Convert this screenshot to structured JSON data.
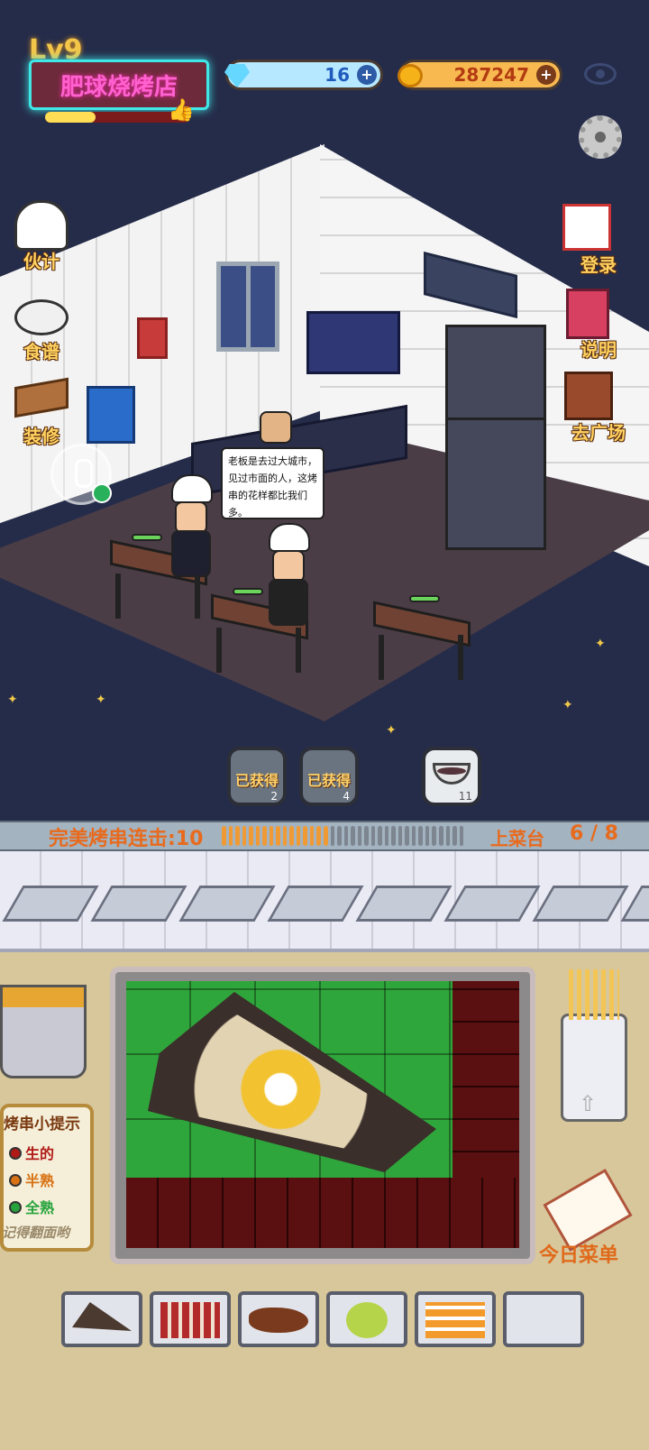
{
  "hud": {
    "level": "Lv9",
    "shop_name": "肥球烧烤店",
    "level_progress": 0.35,
    "gems": "16",
    "coins": "287247"
  },
  "left_menu": [
    {
      "label": "伙计",
      "icon": "chef-icon"
    },
    {
      "label": "食谱",
      "icon": "recipe-plate-icon"
    },
    {
      "label": "装修",
      "icon": "decorate-table-icon"
    }
  ],
  "right_menu": [
    {
      "label": "登录",
      "icon": "calendar-icon"
    },
    {
      "label": "说明",
      "icon": "book-icon"
    },
    {
      "label": "去广场",
      "icon": "door-icon"
    }
  ],
  "speech": "老板是去过大城市，见过市面的人，这烤串的花样都比我们多。",
  "rewards": [
    {
      "label": "已获得",
      "count": "2"
    },
    {
      "label": "已获得",
      "count": "4"
    },
    {
      "label": "",
      "count": "11",
      "icon": "soup-bowl-icon"
    }
  ],
  "combo": {
    "label": "完美烤串连击:",
    "value": "10",
    "segments_total": 36,
    "segments_filled": 16
  },
  "counter": {
    "label": "上菜台",
    "value": "6 / 8"
  },
  "tips": {
    "title": "烤串小提示",
    "raw": "生的",
    "half": "半熟",
    "done": "全熟",
    "flip": "记得翻面哟",
    "colors": {
      "raw": "#b01a16",
      "half": "#d87214",
      "done": "#26a33c"
    }
  },
  "menu_label": "今日菜单",
  "ingredients": [
    {
      "name": "scallion-pancake-icon"
    },
    {
      "name": "meat-skewers-icon"
    },
    {
      "name": "drumstick-icon"
    },
    {
      "name": "bun-icon"
    },
    {
      "name": "shrimp-grill-icon"
    },
    {
      "name": "empty-slot"
    }
  ],
  "colors": {
    "grill_green": "#2fa63b",
    "burnt_red": "#5a0f10",
    "accent_orange": "#e86a1d",
    "neon_pink": "#ff62d0",
    "neon_cyan": "#3fe7e7"
  }
}
